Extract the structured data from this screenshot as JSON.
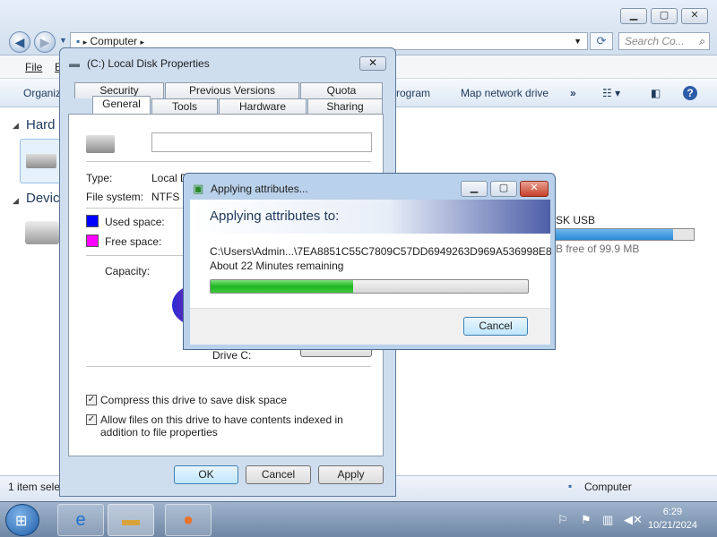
{
  "explorer": {
    "breadcrumb": "Computer",
    "search_placeholder": "Search Co...",
    "menu": [
      "File",
      "E"
    ],
    "toolbar": [
      "Organiz",
      "rogram",
      "Map network drive",
      "»"
    ],
    "sections": [
      "Hard",
      "Devic"
    ],
    "usb_name": "SK USB",
    "usb_free": "B free of 99.9 MB",
    "status_left": "1 item sele",
    "status_right": "Computer"
  },
  "props": {
    "title": "(C:) Local Disk Properties",
    "tabs_top": [
      "Security",
      "Previous Versions",
      "Quota"
    ],
    "tabs_bottom": [
      "General",
      "Tools",
      "Hardware",
      "Sharing"
    ],
    "type_label": "Type:",
    "type_value": "Local D",
    "fs_label": "File system:",
    "fs_value": "NTFS",
    "used_label": "Used space:",
    "free_label": "Free space:",
    "capacity_label": "Capacity:",
    "drive_label": "Drive C:",
    "compress_label": "Compress this drive to save disk space",
    "index_label": "Allow files on this drive to have contents indexed in addition to file properties",
    "ok": "OK",
    "cancel": "Cancel",
    "apply": "Apply",
    "colors": {
      "used": "#0000ff",
      "free": "#ff00ff"
    }
  },
  "apply_dialog": {
    "title": "Applying attributes...",
    "header": "Applying attributes to:",
    "path": "C:\\Users\\Admin...\\7EA8851C55C7809C57DD6949263D969A536998E8",
    "remaining": "About 22 Minutes remaining",
    "progress": 0.45,
    "cancel": "Cancel"
  },
  "taskbar": {
    "time": "6:29",
    "date": "10/21/2024"
  }
}
